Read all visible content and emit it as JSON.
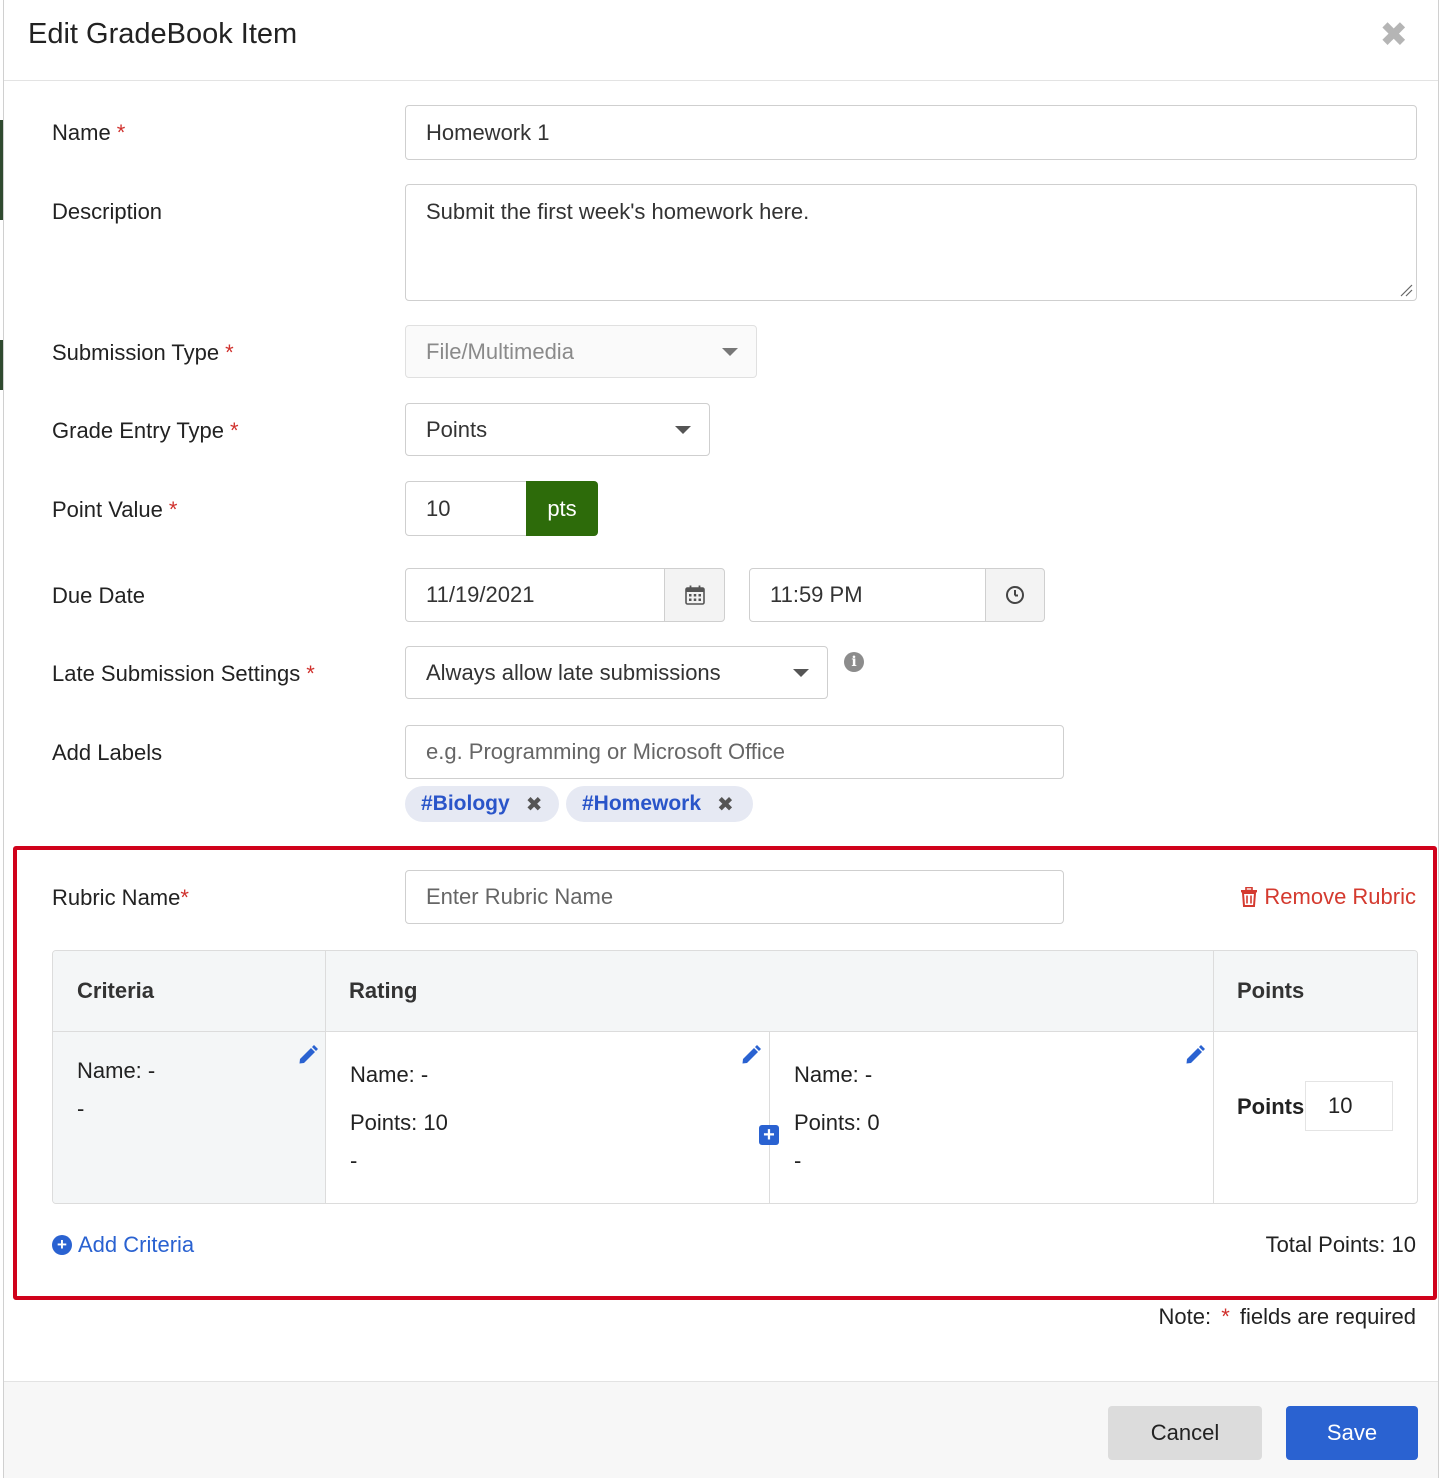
{
  "dialog": {
    "title": "Edit GradeBook Item",
    "close_icon": "close-icon"
  },
  "form": {
    "name": {
      "label": "Name",
      "required_mark": "*",
      "value": "Homework 1"
    },
    "description": {
      "label": "Description",
      "value": "Submit the first week's homework here."
    },
    "submission_type": {
      "label": "Submission Type",
      "required_mark": "*",
      "value": "File/Multimedia"
    },
    "grade_entry_type": {
      "label": "Grade Entry Type",
      "required_mark": "*",
      "value": "Points"
    },
    "point_value": {
      "label": "Point Value",
      "required_mark": "*",
      "value": "10",
      "addon": "pts"
    },
    "due_date": {
      "label": "Due Date",
      "date": "11/19/2021",
      "time": "11:59 PM"
    },
    "late_submission": {
      "label": "Late Submission Settings",
      "required_mark": "*",
      "value": "Always allow late submissions"
    },
    "labels": {
      "label": "Add Labels",
      "placeholder": "e.g. Programming or Microsoft Office",
      "tags": [
        "#Biology",
        "#Homework"
      ]
    }
  },
  "rubric": {
    "name_label": "Rubric Name",
    "required_mark": "*",
    "name_placeholder": "Enter Rubric Name",
    "remove_label": "Remove Rubric",
    "headers": {
      "criteria": "Criteria",
      "rating": "Rating",
      "points": "Points"
    },
    "criteria": {
      "name": "Name: -",
      "description": "-"
    },
    "ratings": [
      {
        "name": "Name: -",
        "points": "Points: 10",
        "description": "-"
      },
      {
        "name": "Name: -",
        "points": "Points: 0",
        "description": "-"
      }
    ],
    "points_label": "Points",
    "points_value": "10",
    "add_criteria_label": "Add Criteria",
    "total_points": "Total Points: 10"
  },
  "note": {
    "prefix": "Note:",
    "mark": "*",
    "suffix": "fields are required"
  },
  "footer": {
    "cancel_label": "Cancel",
    "save_label": "Save"
  },
  "colors": {
    "accent_blue": "#2a62d1",
    "pts_green": "#2d6b0a",
    "danger_red": "#d43a2f",
    "highlight_border": "#d0021b"
  }
}
